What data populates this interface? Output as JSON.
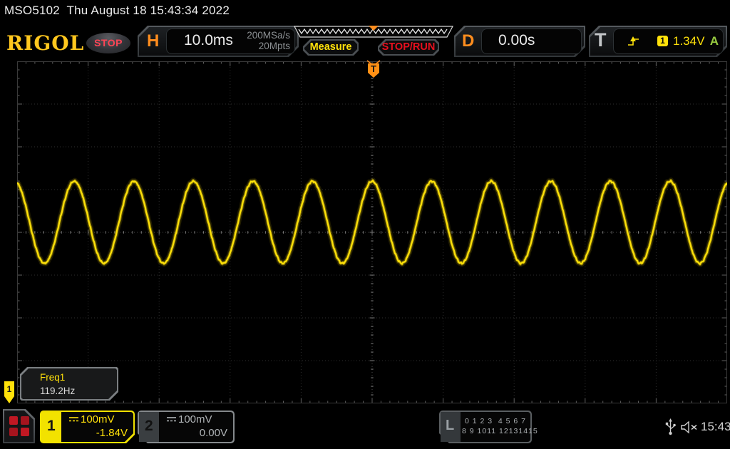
{
  "title_bar": {
    "model": "MSO5102",
    "datetime": "Thu August 18 15:43:34 2022"
  },
  "header": {
    "brand": "RIGOL",
    "run_state": "STOP",
    "horizontal": {
      "label": "H",
      "timebase": "10.0ms",
      "sample_rate": "200MSa/s",
      "memory_depth": "20Mpts"
    },
    "measure_label": "Measure",
    "stop_run_label": "STOP/RUN",
    "delay": {
      "label": "D",
      "value": "0.00s"
    },
    "trigger": {
      "label": "T",
      "edge_icon": "rising-edge-trigger-icon",
      "source_badge": "1",
      "level": "1.34V",
      "mode": "A"
    }
  },
  "trigger_flag_label": "T",
  "measurement": {
    "name": "Freq1",
    "value": "119.2Hz"
  },
  "channels": [
    {
      "id": "1",
      "scale": "100mV",
      "offset": "-1.84V",
      "color": "#ffe10a",
      "active": true
    },
    {
      "id": "2",
      "scale": "100mV",
      "offset": "0.00V",
      "color": "#b0b4b7",
      "active": false
    }
  ],
  "digital": {
    "label": "L",
    "row1": "0 1 2 3  4 5 6 7",
    "row2": "8 9 1011 12131415"
  },
  "status": {
    "time": "15:43",
    "usb_icon": "usb-icon",
    "speaker_icon": "speaker-muted-icon"
  },
  "colors": {
    "channel1": "#ffe10a",
    "channel2": "#9a9ea1",
    "accent_orange": "#ff8d1e",
    "stop_red": "#e8101e",
    "trigger_mode_green": "#97cb40",
    "brand_yellow": "#ffc71e"
  },
  "chart_data": {
    "type": "line",
    "signal": "sine",
    "title": "Channel 1 waveform",
    "frequency_hz": 119.2,
    "period_ms": 8.39,
    "timebase_ms_per_div": 10,
    "volts_per_div_mV": 100,
    "amplitude_divs": 0.96,
    "amplitude_mv": 96,
    "peak_to_peak_mv": 192,
    "vertical_offset_divs_above_center": 0.235,
    "trigger_position_div": 5,
    "peak_aligned_at_trigger": true,
    "grid": {
      "h_divs": 10,
      "v_divs": 8,
      "style": "dotted"
    },
    "color": "#ffe10a"
  }
}
